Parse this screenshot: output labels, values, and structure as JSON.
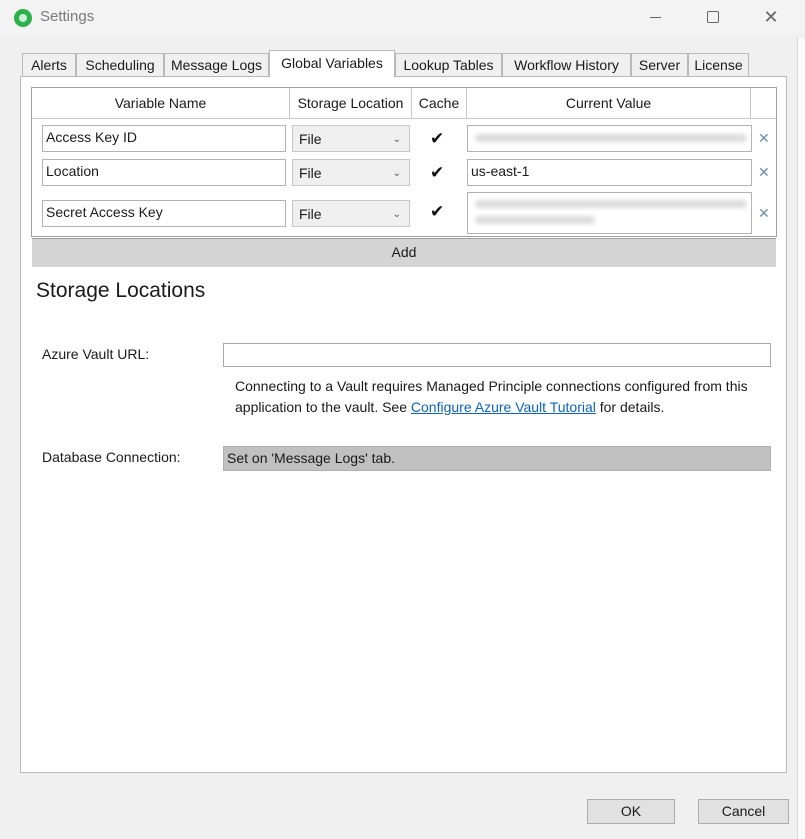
{
  "window": {
    "title": "Settings",
    "icon": "app-gear-icon"
  },
  "tabs": [
    {
      "label": "Alerts",
      "active": false
    },
    {
      "label": "Scheduling",
      "active": false
    },
    {
      "label": "Message Logs",
      "active": false
    },
    {
      "label": "Global Variables",
      "active": true
    },
    {
      "label": "Lookup Tables",
      "active": false
    },
    {
      "label": "Workflow History",
      "active": false
    },
    {
      "label": "Server",
      "active": false
    },
    {
      "label": "License",
      "active": false
    }
  ],
  "grid": {
    "headers": [
      "Variable Name",
      "Storage Location",
      "Cache",
      "Current Value"
    ],
    "rows": [
      {
        "name": "Access Key ID",
        "storage": "File",
        "cache": true,
        "value": ""
      },
      {
        "name": "Location",
        "storage": "File",
        "cache": true,
        "value": "us-east-1"
      },
      {
        "name": "Secret Access Key",
        "storage": "File",
        "cache": true,
        "value": ""
      }
    ],
    "add_label": "Add"
  },
  "storage": {
    "title": "Storage Locations",
    "azure_label": "Azure Vault URL:",
    "azure_value": "",
    "note_before": "Connecting to a Vault requires Managed Principle connections configured from this application to the vault. See ",
    "note_link": "Configure Azure Vault Tutorial",
    "note_after": " for details.",
    "db_label": "Database Connection:",
    "db_value": "Set on 'Message Logs' tab."
  },
  "buttons": {
    "ok": "OK",
    "cancel": "Cancel"
  }
}
